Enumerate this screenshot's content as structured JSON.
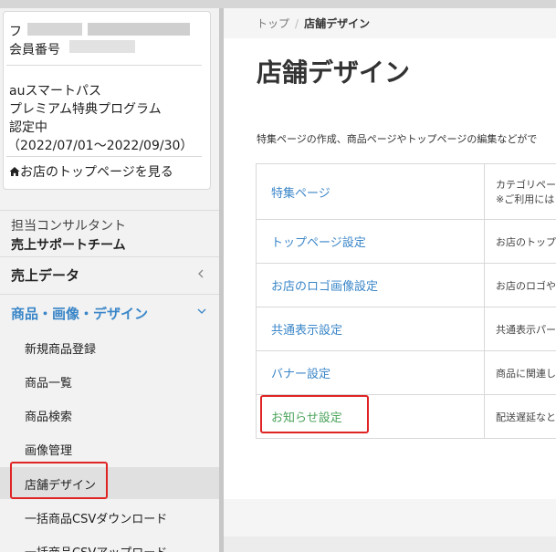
{
  "sidebar": {
    "store": {
      "name_prefix": "フ",
      "member_label": "会員番号",
      "program_line1": "auスマートパス",
      "program_line2": "プレミアム特典プログラム",
      "certified": "認定中",
      "period": "（2022/07/01～2022/09/30）",
      "home_link": "お店のトップページを見る"
    },
    "consultant_label": "担当コンサルタント",
    "consultant_team": "売上サポートチーム",
    "sections": [
      {
        "label": "売上データ",
        "color": "#222222"
      },
      {
        "label": "商品・画像・デザイン",
        "color": "#3a86c8"
      }
    ],
    "sub_items": [
      "新規商品登録",
      "商品一覧",
      "商品検索",
      "画像管理",
      "店舗デザイン",
      "一括商品CSVダウンロード",
      "一括商品CSVアップロード"
    ]
  },
  "breadcrumb": {
    "home": "トップ",
    "current": "店舗デザイン"
  },
  "page": {
    "title": "店舗デザイン",
    "description": "特集ページの作成、商品ページやトップページの編集などがで"
  },
  "table": [
    {
      "label": "特集ページ",
      "desc1": "カテゴリペー",
      "desc2": "※ご利用には"
    },
    {
      "label": "トップページ設定",
      "desc1": "お店のトップ",
      "desc2": ""
    },
    {
      "label": "お店のロゴ画像設定",
      "desc1": "お店のロゴや",
      "desc2": ""
    },
    {
      "label": "共通表示設定",
      "desc1": "共通表示パー",
      "desc2": ""
    },
    {
      "label": "バナー設定",
      "desc1": "商品に関連し",
      "desc2": ""
    },
    {
      "label": "お知らせ設定",
      "desc1": "配送遅延なと",
      "desc2": ""
    }
  ],
  "icons": {
    "home": "house-icon",
    "collapse": "chevron-left-icon",
    "expand": "chevron-down-icon"
  },
  "colors": {
    "link": "#3a86c8",
    "visited_link": "#4aa35a",
    "highlight": "#e02424"
  }
}
